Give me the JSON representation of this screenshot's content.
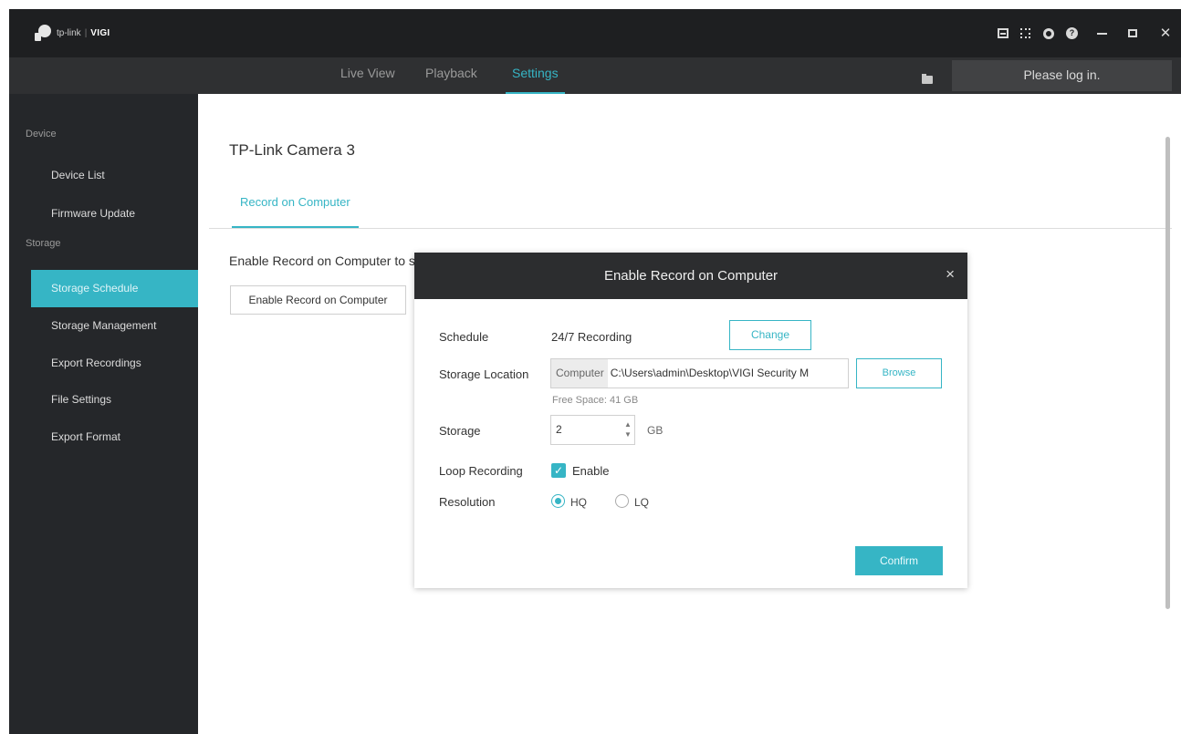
{
  "app": {
    "brand": "tp-link",
    "separator": "|",
    "product": "VIGI"
  },
  "window_icons": [
    "monitor-icon",
    "chip-icon",
    "gear-icon",
    "help-icon",
    "minimize-icon",
    "maximize-icon",
    "close-icon"
  ],
  "nav": {
    "tabs": [
      {
        "label": "Live View",
        "active": false
      },
      {
        "label": "Playback",
        "active": false
      },
      {
        "label": "Settings",
        "active": true
      }
    ],
    "login_label": "Please log in."
  },
  "sidebar": {
    "sections": [
      {
        "label": "Device",
        "items": [
          "Device List",
          "Firmware Update"
        ]
      },
      {
        "label": "Storage",
        "items": [
          "Storage Schedule",
          "Storage Management",
          "Export Recordings",
          "File Settings",
          "Export Format"
        ]
      }
    ],
    "active_item": "Storage Schedule"
  },
  "main": {
    "title": "TP-Link Camera 3",
    "tab": "Record on Computer",
    "description": "Enable Record on Computer to save the recordings to the computer.",
    "enable_button": "Enable Record on Computer"
  },
  "modal": {
    "title": "Enable Record on Computer",
    "close": "×",
    "schedule_label": "Schedule",
    "schedule_value": "24/7 Recording",
    "change_button": "Change",
    "location_label": "Storage Location",
    "location_prefix": "Computer",
    "location_path": "C:\\Users\\admin\\Desktop\\VIGI Security M",
    "browse_button": "Browse",
    "free_space": "Free Space: 41 GB",
    "storage_label": "Storage",
    "storage_value": "2",
    "storage_unit": "GB",
    "loop_label": "Loop Recording",
    "loop_checkbox_label": "Enable",
    "loop_checked": true,
    "resolution_label": "Resolution",
    "resolution_options": [
      {
        "label": "HQ",
        "selected": true
      },
      {
        "label": "LQ",
        "selected": false
      }
    ],
    "confirm_button": "Confirm"
  },
  "colors": {
    "accent": "#36b5c5",
    "titlebar": "#1e1f21",
    "navbar": "#2f3032",
    "sidebar": "#25272a"
  }
}
